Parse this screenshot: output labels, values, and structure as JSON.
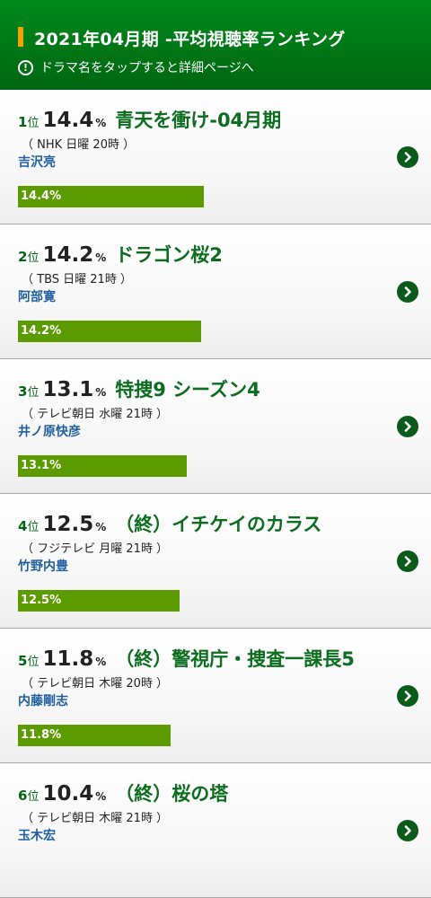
{
  "header": {
    "title": "2021年04月期 -平均視聴率ランキング",
    "hint": "ドラマ名をタップすると詳細ページへ",
    "hint_icon": "!"
  },
  "pct_unit": "%",
  "rank_suffix": "位",
  "bar_max": 15.3,
  "items": [
    {
      "rank": "1",
      "rating": "14.4",
      "value": 14.4,
      "title": "青天を衝け-04月期",
      "meta": "（ NHK 日曜 20時 ）",
      "actor": "吉沢亮",
      "bar_label": "14.4%"
    },
    {
      "rank": "2",
      "rating": "14.2",
      "value": 14.2,
      "title": "ドラゴン桜2",
      "meta": "（ TBS 日曜 21時 ）",
      "actor": "阿部寛",
      "bar_label": "14.2%"
    },
    {
      "rank": "3",
      "rating": "13.1",
      "value": 13.1,
      "title": "特捜9 シーズン4",
      "meta": "（ テレビ朝日 水曜 21時 ）",
      "actor": "井ノ原快彦",
      "bar_label": "13.1%"
    },
    {
      "rank": "4",
      "rating": "12.5",
      "value": 12.5,
      "title": "（終）イチケイのカラス",
      "meta": "（ フジテレビ 月曜 21時 ）",
      "actor": "竹野内豊",
      "bar_label": "12.5%"
    },
    {
      "rank": "5",
      "rating": "11.8",
      "value": 11.8,
      "title": "（終）警視庁・捜査一課長5",
      "meta": "（ テレビ朝日 木曜 20時 ）",
      "actor": "内藤剛志",
      "bar_label": "11.8%"
    },
    {
      "rank": "6",
      "rating": "10.4",
      "value": 10.4,
      "title": "（終）桜の塔",
      "meta": "（ テレビ朝日 木曜 21時 ）",
      "actor": "玉木宏",
      "bar_label": ""
    }
  ]
}
